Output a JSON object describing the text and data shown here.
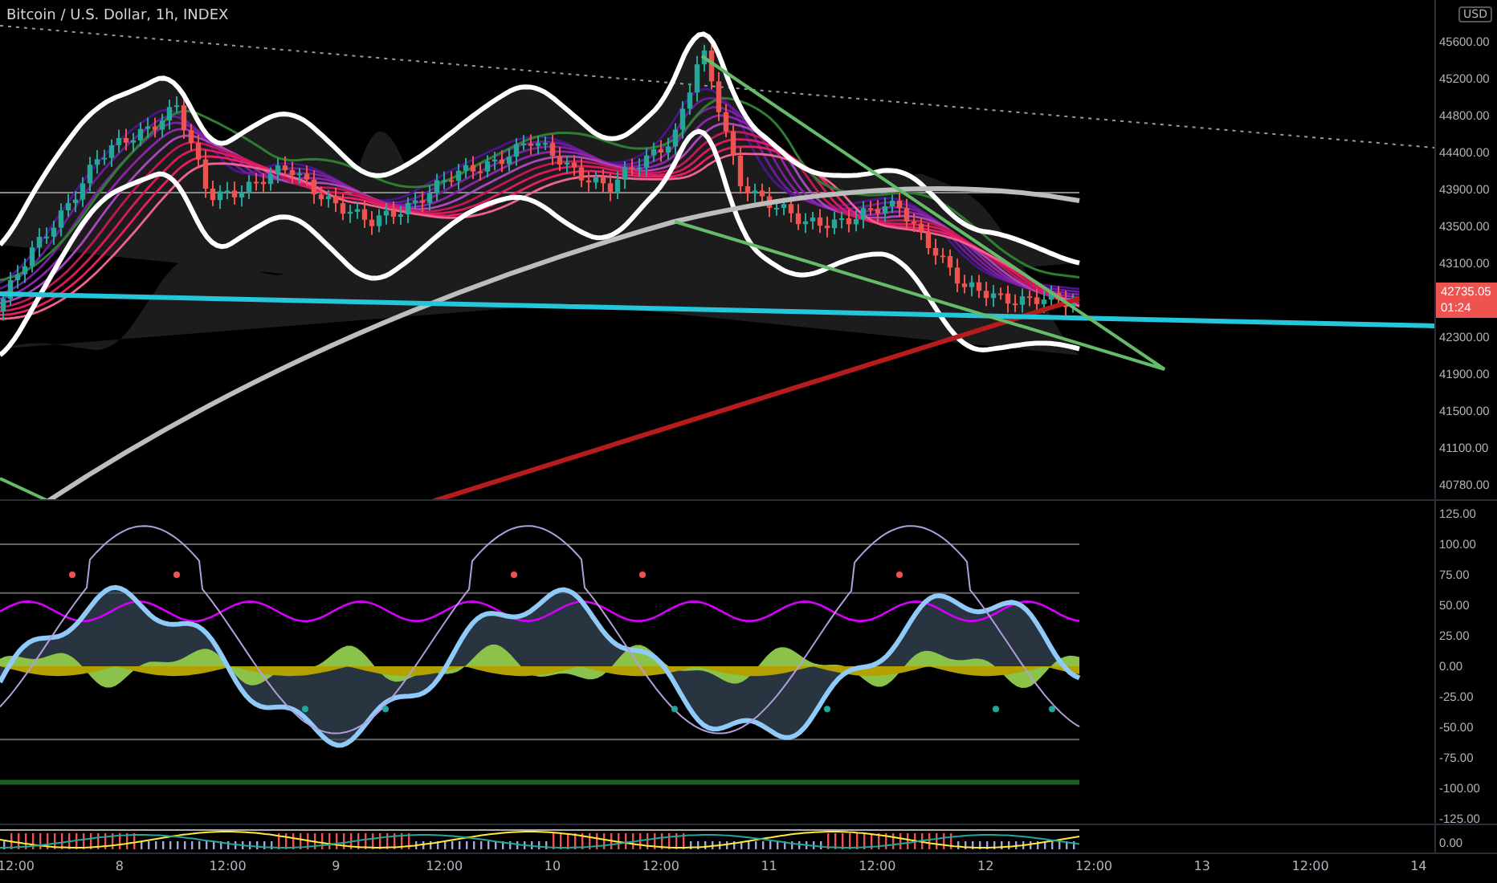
{
  "title": "Bitcoin / U.S. Dollar, 1h, INDEX",
  "currency": "USD",
  "price_axis": [
    "45600.00",
    "45200.00",
    "44800.00",
    "44400.00",
    "43900.00",
    "43500.00",
    "43100.00",
    "42300.00",
    "41900.00",
    "41500.00",
    "41100.00",
    "40780.00"
  ],
  "last_price": {
    "price": "42735.05",
    "countdown": "01:24"
  },
  "oscillator_axis": [
    "125.00",
    "100.00",
    "75.00",
    "50.00",
    "25.00",
    "0.00",
    "-25.00",
    "-50.00",
    "-75.00",
    "-100.00",
    "-125.00"
  ],
  "lower_axis": [
    "0.00"
  ],
  "time_axis": [
    "12:00",
    "8",
    "12:00",
    "9",
    "12:00",
    "10",
    "12:00",
    "11",
    "12:00",
    "12",
    "12:00",
    "13",
    "12:00",
    "14"
  ]
}
